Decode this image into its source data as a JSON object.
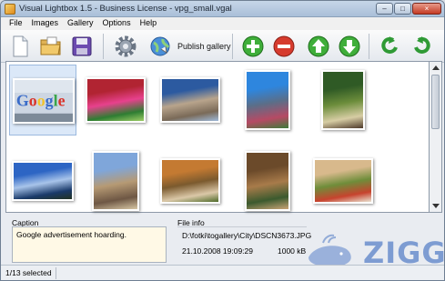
{
  "window": {
    "title": "Visual Lightbox 1.5 - Business License - vpg_small.vgal",
    "controls": {
      "minimize": "–",
      "maximize": "□",
      "close": "×"
    }
  },
  "menu": [
    {
      "label": "File"
    },
    {
      "label": "Images"
    },
    {
      "label": "Gallery"
    },
    {
      "label": "Options"
    },
    {
      "label": "Help"
    }
  ],
  "toolbar": {
    "publish_label": "Publish gallery",
    "icons": [
      "new-document-icon",
      "open-folder-icon",
      "save-disk-icon",
      "gear-icon",
      "publish-globe-icon",
      "add-icon",
      "remove-icon",
      "move-up-icon",
      "move-down-icon",
      "rotate-left-icon",
      "rotate-right-icon"
    ]
  },
  "gallery": {
    "selected_index": 0,
    "thumbnails": [
      {
        "name": "google-advertisement-hoarding",
        "colors": [
          "#3a6cc9",
          "#d9342a",
          "#f2c32e",
          "#3aa54a",
          "#cfd8e3"
        ]
      },
      {
        "name": "red-flowers-garden",
        "colors": [
          "#b12432",
          "#e7418d",
          "#2e7d32",
          "#9ccc65"
        ]
      },
      {
        "name": "city-buildings",
        "colors": [
          "#2c5aa0",
          "#b8a48c",
          "#7a6a58",
          "#9fb9d8"
        ]
      },
      {
        "name": "city-skyscraper-trees",
        "colors": [
          "#2e86de",
          "#5b6e88",
          "#b64a64",
          "#3e7b3a"
        ]
      },
      {
        "name": "palm-tree-yard",
        "colors": [
          "#2f5a25",
          "#6c8d3b",
          "#d7cda4",
          "#4e3a2a"
        ]
      },
      {
        "name": "lake-blue-sky",
        "colors": [
          "#2d65c4",
          "#a8c4ea",
          "#1a3a6a",
          "#223322"
        ]
      },
      {
        "name": "gothic-church-towers",
        "colors": [
          "#7fa6da",
          "#b69a74",
          "#6e5744",
          "#d7c6a4"
        ]
      },
      {
        "name": "autumn-forest-path",
        "colors": [
          "#c47a32",
          "#7b5a2e",
          "#dbc8a8",
          "#4f6a2a"
        ]
      },
      {
        "name": "tree-roots-rocks",
        "colors": [
          "#6b4a2a",
          "#a87b4a",
          "#3b5a2e",
          "#c9a476"
        ]
      },
      {
        "name": "garden-wall-flowers",
        "colors": [
          "#d8b98c",
          "#6f8d3a",
          "#c7432e",
          "#e9e3d2"
        ]
      }
    ]
  },
  "caption": {
    "label": "Caption",
    "text": "Google advertisement hoarding."
  },
  "file_info": {
    "label": "File info",
    "path": "D:\\fotki\\togallery\\City\\DSCN3673.JPG",
    "date": "21.10.2008 19:09:29",
    "size": "1000 kB"
  },
  "watermark": {
    "text": "ZIGG"
  },
  "status": {
    "text": "1/13 selected"
  },
  "colors": {
    "accent": "#3a6fb5",
    "selection": "#dbe8f8",
    "caption_bg": "#fff9e6"
  }
}
